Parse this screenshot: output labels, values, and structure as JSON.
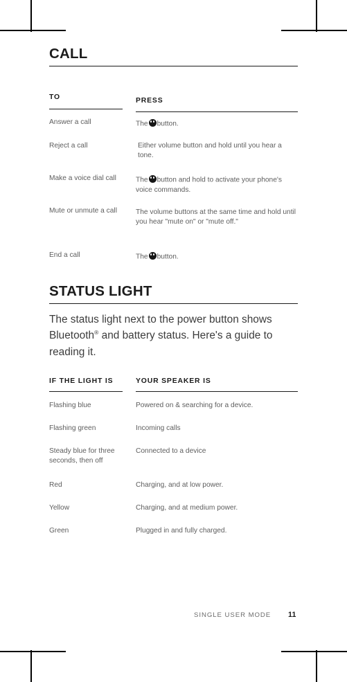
{
  "document": {
    "footer": {
      "label": "SINGLE USER MODE",
      "page_number": "11"
    }
  },
  "call_section": {
    "heading": "CALL",
    "table": {
      "headers": {
        "left": "TO",
        "right": "PRESS"
      },
      "rows": [
        {
          "action": "Answer a call",
          "press_before": "The",
          "icon": "multifunction-button-icon",
          "press_after": "button."
        },
        {
          "action": "Reject a call",
          "press_before": "Either volume button and hold until you hear a tone.",
          "icon": null,
          "press_after": ""
        },
        {
          "action": "Make a voice dial call",
          "press_before": "The",
          "icon": "multifunction-button-icon",
          "press_after": "button and hold to activate your phone's voice commands."
        },
        {
          "action": "Mute or unmute a call",
          "press_before": "The volume buttons at the same time and hold until you hear \"mute on\" or \"mute off.\"",
          "icon": null,
          "press_after": ""
        },
        {
          "action": "End a call",
          "press_before": "The",
          "icon": "multifunction-button-icon",
          "press_after": "button."
        }
      ]
    }
  },
  "status_light_section": {
    "heading": "STATUS LIGHT",
    "intro_part1": "The status light next to the power button shows Bluetooth",
    "intro_superscript": "®",
    "intro_part2": " and battery status. Here's a guide to reading it.",
    "table": {
      "headers": {
        "left": "IF THE LIGHT IS",
        "right": "YOUR SPEAKER IS"
      },
      "rows": [
        {
          "light": "Flashing blue",
          "speaker": "Powered on & searching for a device."
        },
        {
          "light": "Flashing green",
          "speaker": "Incoming calls"
        },
        {
          "light": "Steady blue for three seconds, then off",
          "speaker": "Connected to a device"
        },
        {
          "light": "Red",
          "speaker": "Charging, and at low power."
        },
        {
          "light": "Yellow",
          "speaker": "Charging, and at medium power."
        },
        {
          "light": "Green",
          "speaker": "Plugged in and fully charged."
        }
      ]
    }
  }
}
